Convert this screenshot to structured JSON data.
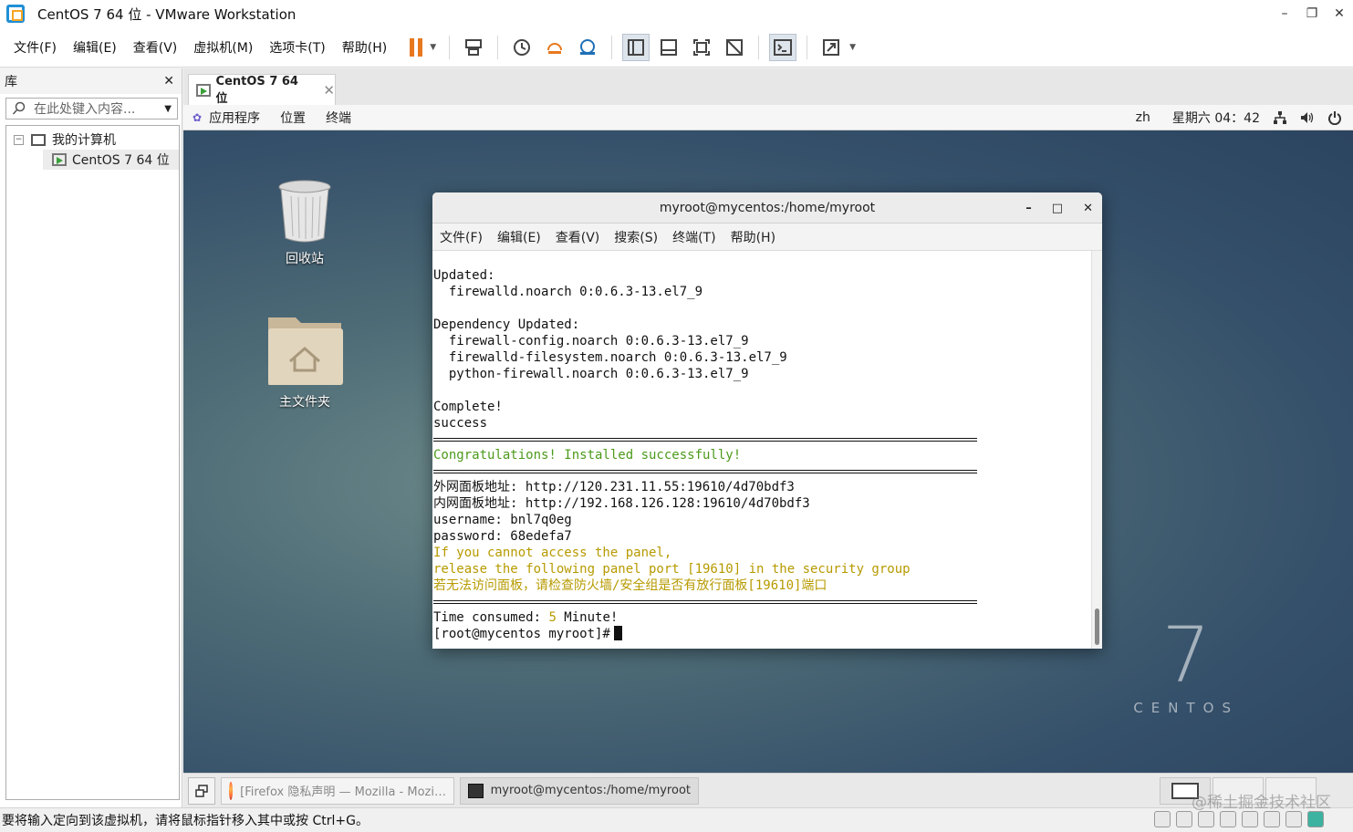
{
  "window": {
    "title": "CentOS 7 64 位 - VMware Workstation",
    "controls": [
      "–",
      "❐",
      "✕"
    ]
  },
  "menu": [
    "文件(F)",
    "编辑(E)",
    "查看(V)",
    "虚拟机(M)",
    "选项卡(T)",
    "帮助(H)"
  ],
  "library": {
    "title": "库",
    "close": "✕",
    "search_placeholder": "在此处键入内容...",
    "tree": {
      "root": "我的计算机",
      "toggle": "−",
      "vm": "CentOS 7 64 位"
    }
  },
  "tab": {
    "label": "CentOS 7 64 位",
    "close": "✕"
  },
  "gnome": {
    "apps": "应用程序",
    "places": "位置",
    "terminal": "终端",
    "lang": "zh",
    "clock": "星期六 04：42"
  },
  "desktop": {
    "trash_label": "回收站",
    "home_label": "主文件夹",
    "logo_number": "7",
    "logo_word": "CENTOS"
  },
  "terminal": {
    "title": "myroot@mycentos:/home/myroot",
    "controls": [
      "–",
      "□",
      "✕"
    ],
    "menu": [
      "文件(F)",
      "编辑(E)",
      "查看(V)",
      "搜索(S)",
      "终端(T)",
      "帮助(H)"
    ],
    "lines": {
      "l1": "Updated:",
      "l2": "  firewalld.noarch 0:0.6.3-13.el7_9",
      "l3": "Dependency Updated:",
      "l4": "  firewall-config.noarch 0:0.6.3-13.el7_9",
      "l5": "  firewalld-filesystem.noarch 0:0.6.3-13.el7_9",
      "l6": "  python-firewall.noarch 0:0.6.3-13.el7_9",
      "l7": "Complete!",
      "l8": "success",
      "congrats": "Congratulations! Installed successfully!",
      "ext_addr": "外网面板地址: http://120.231.11.55:19610/4d70bdf3",
      "int_addr": "内网面板地址: http://192.168.126.128:19610/4d70bdf3",
      "username": "username: bnl7q0eg",
      "password": "password: 68edefa7",
      "warn1": "If you cannot access the panel,",
      "warn2": "release the following panel port [19610] in the security group",
      "warn3": "若无法访问面板，请检查防火墙/安全组是否有放行面板[19610]端口",
      "time_prefix": "Time consumed: ",
      "time_value": "5",
      "time_suffix": " Minute!",
      "prompt": "[root@mycentos myroot]#"
    }
  },
  "taskbar": {
    "firefox": "[Firefox 隐私声明 — Mozilla - Mozi…",
    "terminal": "myroot@mycentos:/home/myroot"
  },
  "status": {
    "text": "要将输入定向到该虚拟机，请将鼠标指针移入其中或按 Ctrl+G。"
  },
  "watermark": "@稀土掘金技术社区",
  "colors": {
    "terminal_green": "#4c9a1b",
    "terminal_yellow": "#b79a00",
    "pause_orange": "#e8781e"
  }
}
